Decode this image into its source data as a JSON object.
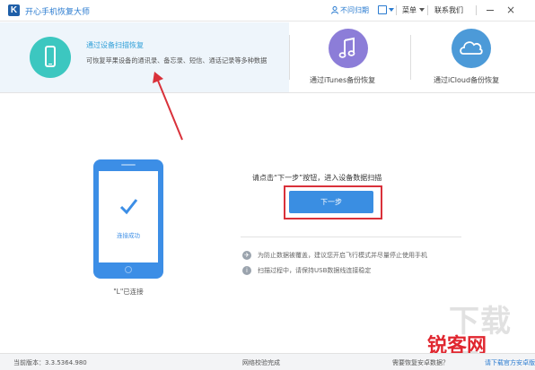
{
  "titlebar": {
    "logo_letter": "K",
    "app_title": "开心手机恢复大师",
    "user_label": "不问归期",
    "menu_label": "菜单",
    "contact_label": "联系我们",
    "close_glyph": "×"
  },
  "modes": [
    {
      "title": "通过设备扫描恢复",
      "desc": "可恢复苹果设备的通讯录、备忘录、短信、通话记录等多种数据",
      "icon": "phone-icon",
      "color": "#3cc7c0"
    },
    {
      "title": "通过iTunes备份恢复",
      "icon": "music-note-icon",
      "color": "#8c7dd8"
    },
    {
      "title": "通过iCloud备份恢复",
      "icon": "cloud-icon",
      "color": "#4c9ad8"
    }
  ],
  "device": {
    "status": "连接成功",
    "name_label": "\"L\"已连接"
  },
  "main": {
    "instruction": "请点击“下一步”按钮，进入设备数据扫描",
    "next_button": "下一步",
    "tips": [
      "为防止数据被覆盖，建议您开启飞行模式并尽量停止使用手机",
      "扫描过程中，请保持USB数据线连接稳定"
    ]
  },
  "statusbar": {
    "version": "当前版本：3.3.5364.980",
    "network": "网络校验完成",
    "help": "需要恢复安卓数据？",
    "help_link": "请下载官方安卓版"
  },
  "watermark": {
    "text1": "下载吧",
    "text2": "锐客网"
  },
  "colors": {
    "accent": "#2a7bd0",
    "button": "#3a8ee2",
    "highlight": "#d9313a"
  }
}
